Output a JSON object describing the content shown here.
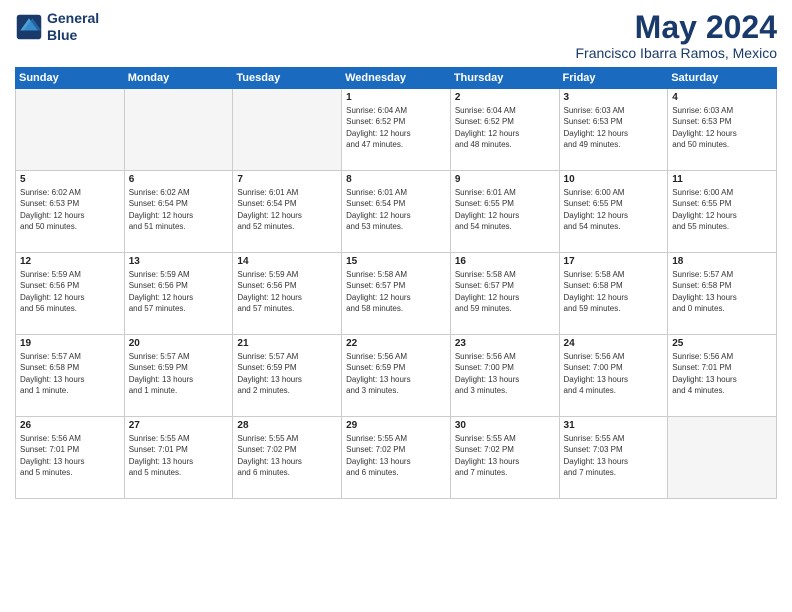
{
  "header": {
    "logo_line1": "General",
    "logo_line2": "Blue",
    "month_title": "May 2024",
    "location": "Francisco Ibarra Ramos, Mexico"
  },
  "weekdays": [
    "Sunday",
    "Monday",
    "Tuesday",
    "Wednesday",
    "Thursday",
    "Friday",
    "Saturday"
  ],
  "weeks": [
    [
      {
        "day": "",
        "info": ""
      },
      {
        "day": "",
        "info": ""
      },
      {
        "day": "",
        "info": ""
      },
      {
        "day": "1",
        "info": "Sunrise: 6:04 AM\nSunset: 6:52 PM\nDaylight: 12 hours\nand 47 minutes."
      },
      {
        "day": "2",
        "info": "Sunrise: 6:04 AM\nSunset: 6:52 PM\nDaylight: 12 hours\nand 48 minutes."
      },
      {
        "day": "3",
        "info": "Sunrise: 6:03 AM\nSunset: 6:53 PM\nDaylight: 12 hours\nand 49 minutes."
      },
      {
        "day": "4",
        "info": "Sunrise: 6:03 AM\nSunset: 6:53 PM\nDaylight: 12 hours\nand 50 minutes."
      }
    ],
    [
      {
        "day": "5",
        "info": "Sunrise: 6:02 AM\nSunset: 6:53 PM\nDaylight: 12 hours\nand 50 minutes."
      },
      {
        "day": "6",
        "info": "Sunrise: 6:02 AM\nSunset: 6:54 PM\nDaylight: 12 hours\nand 51 minutes."
      },
      {
        "day": "7",
        "info": "Sunrise: 6:01 AM\nSunset: 6:54 PM\nDaylight: 12 hours\nand 52 minutes."
      },
      {
        "day": "8",
        "info": "Sunrise: 6:01 AM\nSunset: 6:54 PM\nDaylight: 12 hours\nand 53 minutes."
      },
      {
        "day": "9",
        "info": "Sunrise: 6:01 AM\nSunset: 6:55 PM\nDaylight: 12 hours\nand 54 minutes."
      },
      {
        "day": "10",
        "info": "Sunrise: 6:00 AM\nSunset: 6:55 PM\nDaylight: 12 hours\nand 54 minutes."
      },
      {
        "day": "11",
        "info": "Sunrise: 6:00 AM\nSunset: 6:55 PM\nDaylight: 12 hours\nand 55 minutes."
      }
    ],
    [
      {
        "day": "12",
        "info": "Sunrise: 5:59 AM\nSunset: 6:56 PM\nDaylight: 12 hours\nand 56 minutes."
      },
      {
        "day": "13",
        "info": "Sunrise: 5:59 AM\nSunset: 6:56 PM\nDaylight: 12 hours\nand 57 minutes."
      },
      {
        "day": "14",
        "info": "Sunrise: 5:59 AM\nSunset: 6:56 PM\nDaylight: 12 hours\nand 57 minutes."
      },
      {
        "day": "15",
        "info": "Sunrise: 5:58 AM\nSunset: 6:57 PM\nDaylight: 12 hours\nand 58 minutes."
      },
      {
        "day": "16",
        "info": "Sunrise: 5:58 AM\nSunset: 6:57 PM\nDaylight: 12 hours\nand 59 minutes."
      },
      {
        "day": "17",
        "info": "Sunrise: 5:58 AM\nSunset: 6:58 PM\nDaylight: 12 hours\nand 59 minutes."
      },
      {
        "day": "18",
        "info": "Sunrise: 5:57 AM\nSunset: 6:58 PM\nDaylight: 13 hours\nand 0 minutes."
      }
    ],
    [
      {
        "day": "19",
        "info": "Sunrise: 5:57 AM\nSunset: 6:58 PM\nDaylight: 13 hours\nand 1 minute."
      },
      {
        "day": "20",
        "info": "Sunrise: 5:57 AM\nSunset: 6:59 PM\nDaylight: 13 hours\nand 1 minute."
      },
      {
        "day": "21",
        "info": "Sunrise: 5:57 AM\nSunset: 6:59 PM\nDaylight: 13 hours\nand 2 minutes."
      },
      {
        "day": "22",
        "info": "Sunrise: 5:56 AM\nSunset: 6:59 PM\nDaylight: 13 hours\nand 3 minutes."
      },
      {
        "day": "23",
        "info": "Sunrise: 5:56 AM\nSunset: 7:00 PM\nDaylight: 13 hours\nand 3 minutes."
      },
      {
        "day": "24",
        "info": "Sunrise: 5:56 AM\nSunset: 7:00 PM\nDaylight: 13 hours\nand 4 minutes."
      },
      {
        "day": "25",
        "info": "Sunrise: 5:56 AM\nSunset: 7:01 PM\nDaylight: 13 hours\nand 4 minutes."
      }
    ],
    [
      {
        "day": "26",
        "info": "Sunrise: 5:56 AM\nSunset: 7:01 PM\nDaylight: 13 hours\nand 5 minutes."
      },
      {
        "day": "27",
        "info": "Sunrise: 5:55 AM\nSunset: 7:01 PM\nDaylight: 13 hours\nand 5 minutes."
      },
      {
        "day": "28",
        "info": "Sunrise: 5:55 AM\nSunset: 7:02 PM\nDaylight: 13 hours\nand 6 minutes."
      },
      {
        "day": "29",
        "info": "Sunrise: 5:55 AM\nSunset: 7:02 PM\nDaylight: 13 hours\nand 6 minutes."
      },
      {
        "day": "30",
        "info": "Sunrise: 5:55 AM\nSunset: 7:02 PM\nDaylight: 13 hours\nand 7 minutes."
      },
      {
        "day": "31",
        "info": "Sunrise: 5:55 AM\nSunset: 7:03 PM\nDaylight: 13 hours\nand 7 minutes."
      },
      {
        "day": "",
        "info": ""
      }
    ]
  ]
}
